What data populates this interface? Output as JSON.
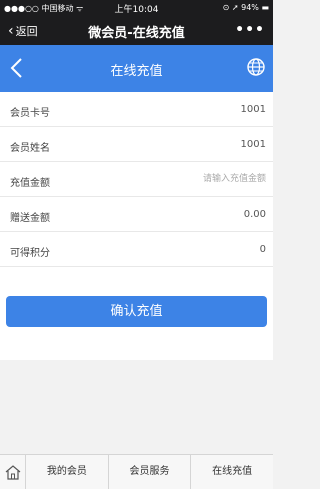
{
  "status_bar": {
    "carrier": "●●●○○ 中国移动 ᯤ",
    "time": "上午10:04",
    "battery": "⊙ ➚ 94% ▬"
  },
  "wechat_header": {
    "back_label": "返回",
    "title": "微会员-在线充值",
    "more_label": "•••"
  },
  "app_header": {
    "title": "在线充值",
    "accent_color": "#3d83e6"
  },
  "form": {
    "card_no_label": "会员卡号",
    "card_no_value": "1001",
    "name_label": "会员姓名",
    "name_value": "1001",
    "amount_label": "充值金额",
    "amount_placeholder": "请输入充值金额",
    "bonus_label": "赠送金额",
    "bonus_value": "0.00",
    "points_label": "可得积分",
    "points_value": "0"
  },
  "confirm_button": "确认充值",
  "tabbar": {
    "home_icon": "home-icon",
    "tab1": "我的会员",
    "tab2": "会员服务",
    "tab3": "在线充值"
  }
}
